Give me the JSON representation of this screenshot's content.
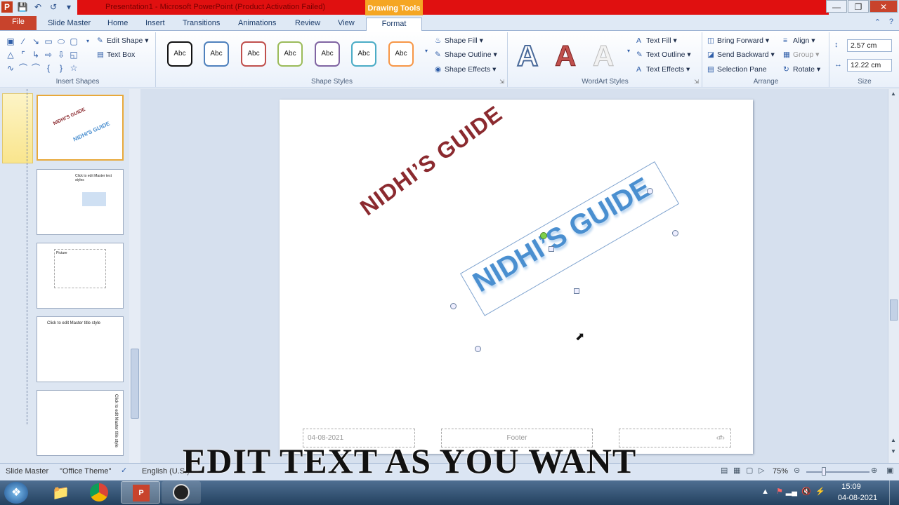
{
  "window": {
    "title": "Presentation1 - Microsoft PowerPoint (Product Activation Failed)",
    "contextual_tab": "Drawing Tools"
  },
  "tabs": [
    "File",
    "Slide Master",
    "Home",
    "Insert",
    "Transitions",
    "Animations",
    "Review",
    "View",
    "Format"
  ],
  "ribbon": {
    "insert_shapes": {
      "label": "Insert Shapes",
      "edit_shape": "Edit Shape",
      "text_box": "Text Box"
    },
    "shape_styles": {
      "label": "Shape Styles",
      "abc": "Abc",
      "shape_fill": "Shape Fill",
      "shape_outline": "Shape Outline",
      "shape_effects": "Shape Effects"
    },
    "wordart": {
      "label": "WordArt Styles",
      "letter": "A",
      "text_fill": "Text Fill",
      "text_outline": "Text Outline",
      "text_effects": "Text Effects"
    },
    "arrange": {
      "label": "Arrange",
      "bring_forward": "Bring Forward",
      "send_backward": "Send Backward",
      "selection_pane": "Selection Pane",
      "align": "Align",
      "group": "Group",
      "rotate": "Rotate"
    },
    "size": {
      "label": "Size",
      "height": "2.57 cm",
      "width": "12.22 cm"
    }
  },
  "thumbs": {
    "t1a": "NIDHI'S GUIDE",
    "t1b": "NIDHI'S GUIDE",
    "t2": "Click to edit Master text styles",
    "t3": "Picture",
    "t4": "Click to edit Master title style",
    "t5": "Click to edit Master title style"
  },
  "slide": {
    "wordart1": "NIDHI’S GUIDE",
    "wordart2": "NIDHI’S GUIDE",
    "footer_date": "04-08-2021",
    "footer_text": "Footer",
    "footer_num": "‹#›"
  },
  "status": {
    "view": "Slide Master",
    "theme": "\"Office Theme\"",
    "language": "English (U.S.)",
    "zoom": "75%"
  },
  "overlay_caption": "EDIT TEXT AS YOU WANT",
  "tray": {
    "time": "15:09",
    "date": "04-08-2021"
  },
  "colors": {
    "accent": "#c8432c",
    "wordart_red": "#8b2a2f",
    "wordart_blue": "#4a8fd0",
    "drawing_tools": "#f5a623"
  }
}
